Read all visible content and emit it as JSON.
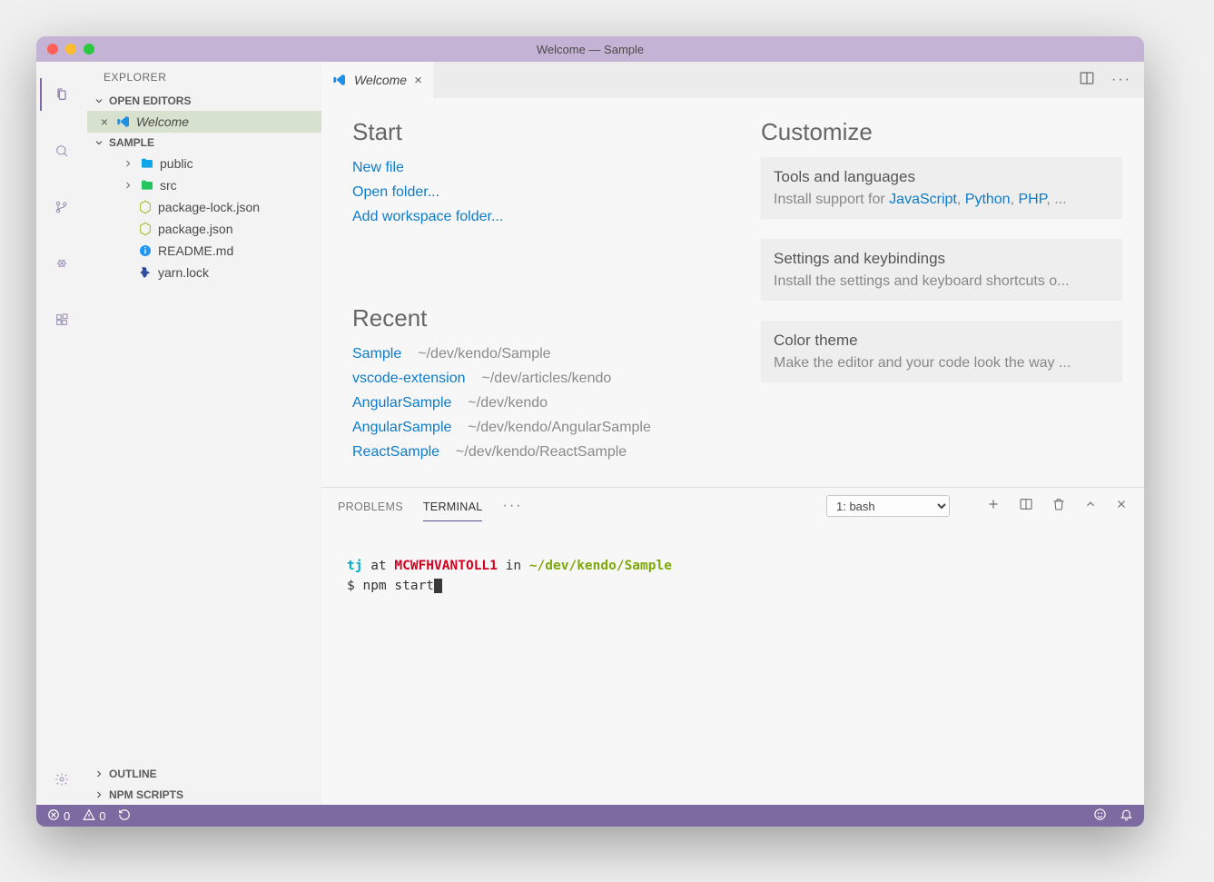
{
  "window": {
    "title": "Welcome — Sample"
  },
  "sidebar": {
    "heading": "EXPLORER",
    "openEditors": {
      "label": "OPEN EDITORS",
      "items": [
        {
          "label": "Welcome"
        }
      ]
    },
    "workspace": {
      "label": "SAMPLE",
      "items": [
        {
          "label": "public"
        },
        {
          "label": "src"
        },
        {
          "label": "package-lock.json"
        },
        {
          "label": "package.json"
        },
        {
          "label": "README.md"
        },
        {
          "label": "yarn.lock"
        }
      ]
    },
    "outline": {
      "label": "OUTLINE"
    },
    "npmScripts": {
      "label": "NPM SCRIPTS"
    }
  },
  "tab": {
    "label": "Welcome"
  },
  "welcome": {
    "startTitle": "Start",
    "startLinks": [
      {
        "label": "New file"
      },
      {
        "label": "Open folder..."
      },
      {
        "label": "Add workspace folder..."
      }
    ],
    "recentTitle": "Recent",
    "recent": [
      {
        "name": "Sample",
        "path": "~/dev/kendo/Sample"
      },
      {
        "name": "vscode-extension",
        "path": "~/dev/articles/kendo"
      },
      {
        "name": "AngularSample",
        "path": "~/dev/kendo"
      },
      {
        "name": "AngularSample",
        "path": "~/dev/kendo/AngularSample"
      },
      {
        "name": "ReactSample",
        "path": "~/dev/kendo/ReactSample"
      }
    ],
    "customizeTitle": "Customize",
    "customize": {
      "tools": {
        "title": "Tools and languages",
        "prefix": "Install support for ",
        "links": [
          "JavaScript",
          "Python",
          "PHP"
        ],
        "suffix": ", ..."
      },
      "settings": {
        "title": "Settings and keybindings",
        "body": "Install the settings and keyboard shortcuts o..."
      },
      "theme": {
        "title": "Color theme",
        "body": "Make the editor and your code look the way ..."
      }
    }
  },
  "panel": {
    "tabs": {
      "problems": "PROBLEMS",
      "terminal": "TERMINAL"
    },
    "select": "1: bash",
    "terminal": {
      "user": "tj",
      "at": " at ",
      "host": "MCWFHVANTOLL1",
      "in": " in ",
      "cwd": "~/dev/kendo/Sample",
      "prompt": "$ ",
      "cmd": "npm start"
    }
  },
  "status": {
    "errors": "0",
    "warnings": "0"
  }
}
